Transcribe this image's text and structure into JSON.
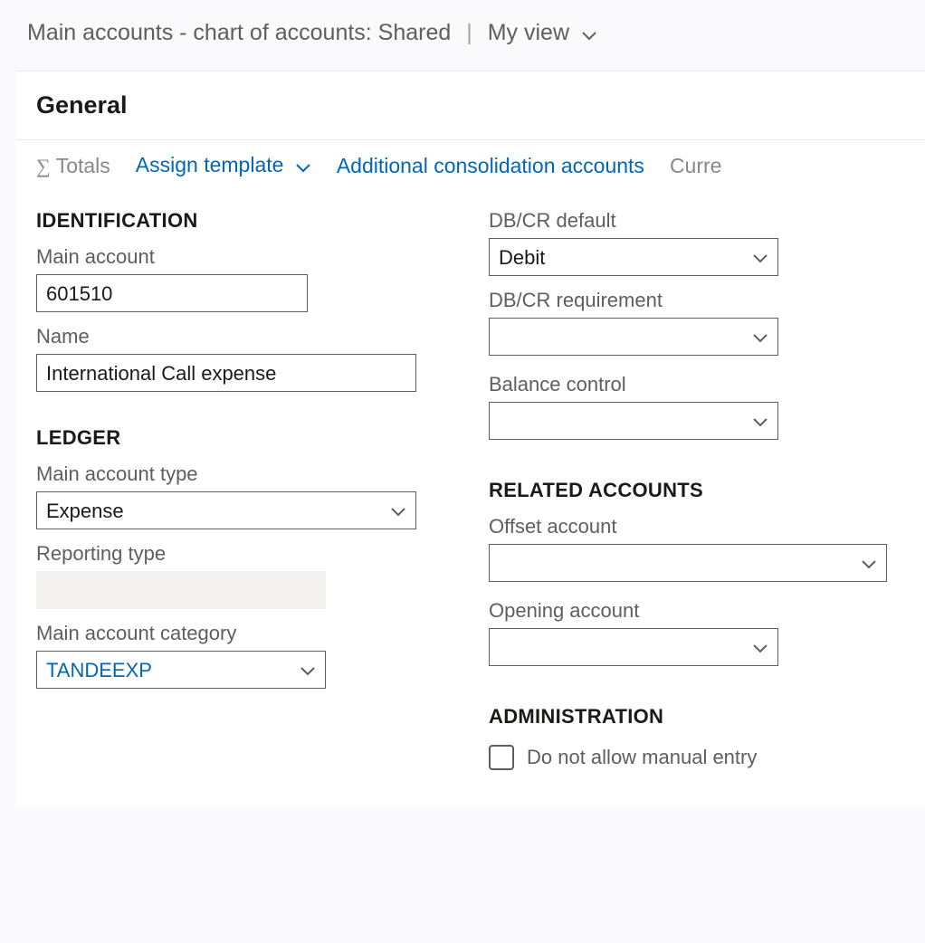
{
  "header": {
    "title_left": "Main accounts - chart of accounts: Shared",
    "separator": "|",
    "view_label": "My view"
  },
  "panel": {
    "title": "General"
  },
  "toolbar": {
    "totals_label": "Totals",
    "assign_template_label": "Assign template",
    "additional_consolidation_label": "Additional consolidation accounts",
    "currency_label_truncated": "Curre"
  },
  "sections": {
    "identification": "IDENTIFICATION",
    "ledger": "LEDGER",
    "related_accounts": "RELATED ACCOUNTS",
    "administration": "ADMINISTRATION"
  },
  "fields": {
    "main_account": {
      "label": "Main account",
      "value": "601510"
    },
    "name": {
      "label": "Name",
      "value": "International Call expense"
    },
    "main_account_type": {
      "label": "Main account type",
      "value": "Expense"
    },
    "reporting_type": {
      "label": "Reporting type",
      "value": ""
    },
    "main_account_category": {
      "label": "Main account category",
      "value": "TANDEEXP"
    },
    "dbcr_default": {
      "label": "DB/CR default",
      "value": "Debit"
    },
    "dbcr_requirement": {
      "label": "DB/CR requirement",
      "value": ""
    },
    "balance_control": {
      "label": "Balance control",
      "value": ""
    },
    "offset_account": {
      "label": "Offset account",
      "value": ""
    },
    "opening_account": {
      "label": "Opening account",
      "value": ""
    },
    "do_not_allow_manual": {
      "label": "Do not allow manual entry",
      "checked": false
    }
  }
}
